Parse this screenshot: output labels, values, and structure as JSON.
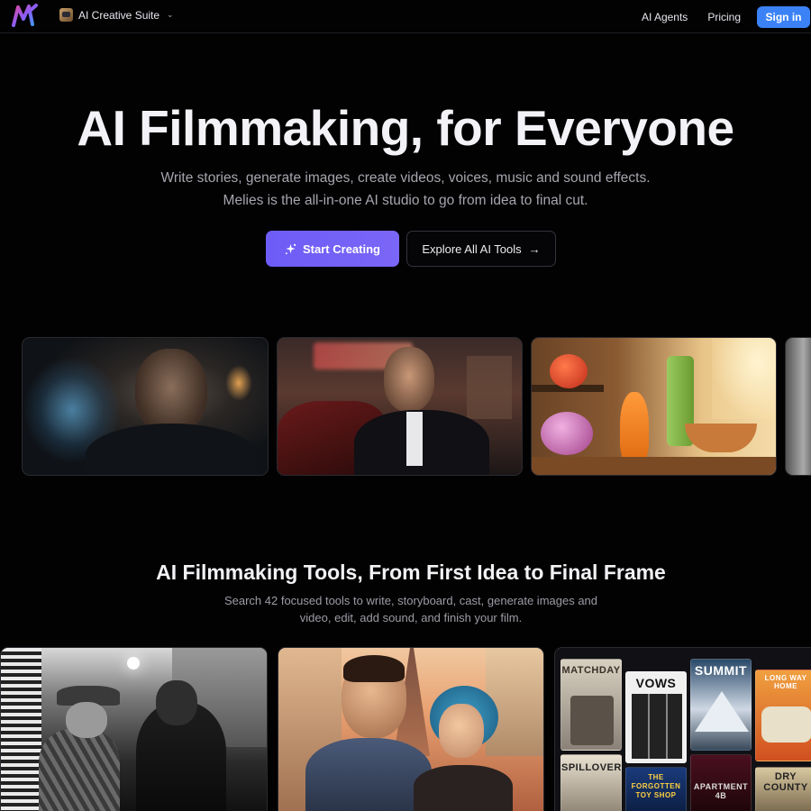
{
  "header": {
    "suite_label": "AI Creative Suite",
    "nav": [
      "AI Agents",
      "Pricing"
    ],
    "signin_label": "Sign in",
    "accent": "#3b82f6"
  },
  "hero": {
    "title": "AI Filmmaking, for Everyone",
    "subtitle_line1": "Write stories, generate images, create videos, voices, music and sound effects.",
    "subtitle_line2": "Melies is the all-in-one AI studio to go from idea to final cut.",
    "primary_cta": "Start Creating",
    "secondary_cta": "Explore All AI Tools",
    "primary_color": "#6d5cf6"
  },
  "gallery": {
    "images": [
      "noir-man-smoke-image",
      "man-smoking-by-car-image",
      "animated-vegetables-kitchen-image",
      "partial-image"
    ]
  },
  "tools_section": {
    "title": "AI Filmmaking Tools, From First Idea to Final Frame",
    "subtitle_line1": "Search 42 focused tools to write, storyboard, cast, generate images and",
    "subtitle_line2": "video, edit, add sound, and finish your film.",
    "posters": [
      "MATCHDAY",
      "VOWS",
      "SUMMIT",
      "LONG WAY HOME",
      "SPILLOVER",
      "THE FORGOTTEN TOY SHOP",
      "APARTMENT 4B",
      "DRY COUNTY"
    ]
  }
}
